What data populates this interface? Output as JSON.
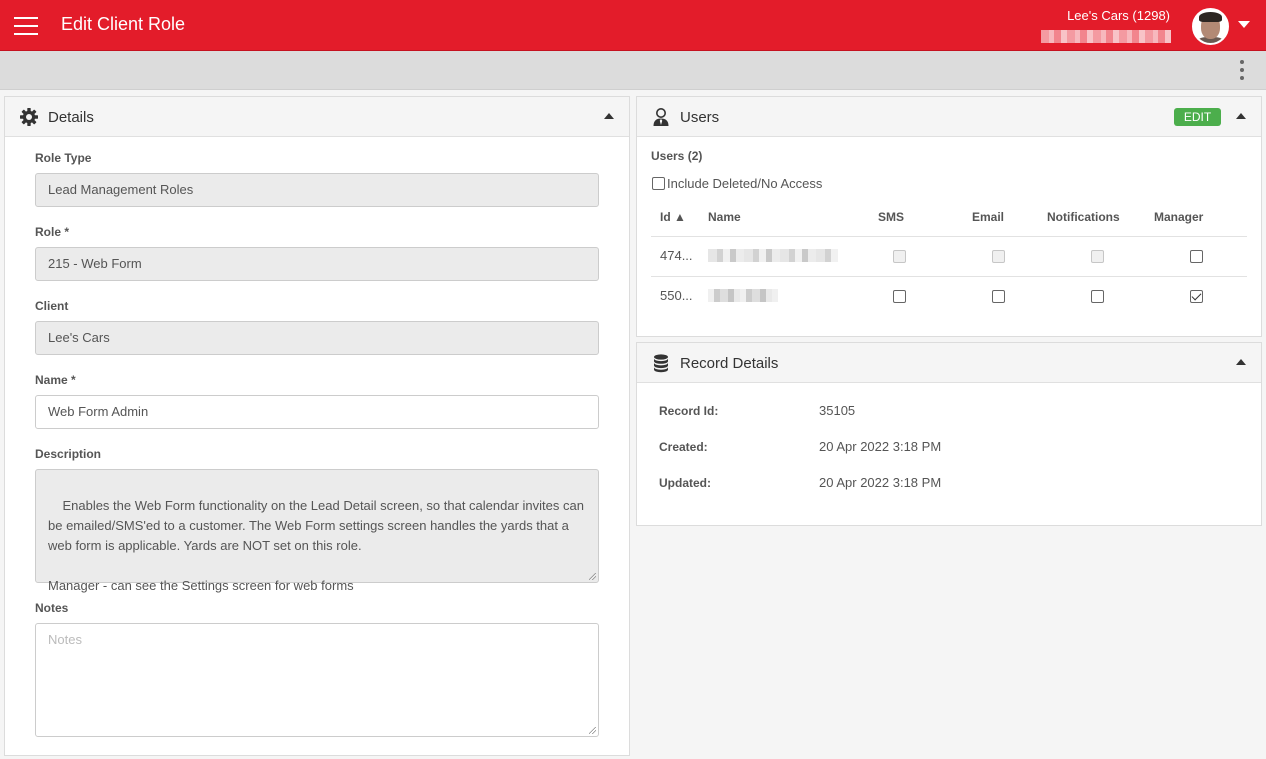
{
  "header": {
    "title": "Edit Client Role",
    "account_name": "Lee's Cars (1298)"
  },
  "details": {
    "title": "Details",
    "role_type": {
      "label": "Role Type",
      "value": "Lead Management Roles"
    },
    "role": {
      "label": "Role *",
      "value": "215 - Web Form"
    },
    "client": {
      "label": "Client",
      "value": "Lee's Cars"
    },
    "name": {
      "label": "Name *",
      "value": "Web Form Admin"
    },
    "description": {
      "label": "Description",
      "value": "Enables the Web Form functionality on the Lead Detail screen, so that calendar invites can be emailed/SMS'ed to a customer. The Web Form settings screen handles the yards that a web form is applicable. Yards are NOT set on this role.\n\nManager - can see the Settings screen for web forms"
    },
    "notes": {
      "label": "Notes",
      "placeholder": "Notes",
      "value": ""
    }
  },
  "users": {
    "title": "Users",
    "edit_label": "EDIT",
    "count_label": "Users (2)",
    "include_deleted_label": "Include Deleted/No Access",
    "include_deleted_checked": false,
    "columns": [
      "Id ▲",
      "Name",
      "SMS",
      "Email",
      "Notifications",
      "Manager"
    ],
    "rows": [
      {
        "id": "474...",
        "sms": false,
        "email": false,
        "notifications": false,
        "manager": false,
        "disabled": true
      },
      {
        "id": "550...",
        "sms": false,
        "email": false,
        "notifications": false,
        "manager": true,
        "disabled": false
      }
    ]
  },
  "record_details": {
    "title": "Record Details",
    "record_id_label": "Record Id:",
    "record_id": "35105",
    "created_label": "Created:",
    "created": "20 Apr 2022 3:18 PM",
    "updated_label": "Updated:",
    "updated": "20 Apr 2022 3:18 PM"
  },
  "colors": {
    "brand_red": "#e31c2a",
    "edit_green": "#4cae4c"
  },
  "icons": [
    "menu-icon",
    "chevron-down-icon",
    "more-vertical-icon",
    "gear-icon",
    "user-tie-icon",
    "database-icon",
    "chevron-up-icon"
  ]
}
